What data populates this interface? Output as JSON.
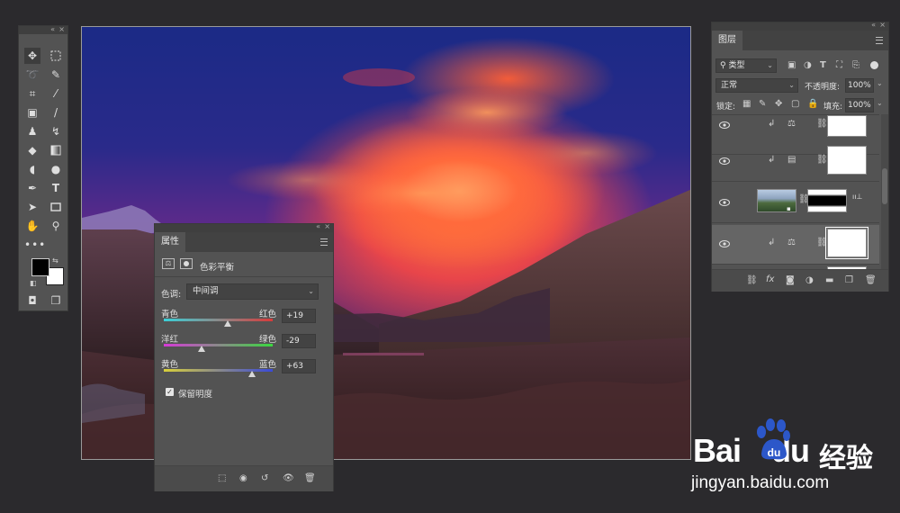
{
  "properties": {
    "tab": "属性",
    "title": "色彩平衡",
    "tone_label": "色调:",
    "tone_value": "中间调",
    "sliders": [
      {
        "left": "青色",
        "right": "红色",
        "value": "+19",
        "pos": 0.59
      },
      {
        "left": "洋红",
        "right": "绿色",
        "value": "-29",
        "pos": 0.35
      },
      {
        "left": "黄色",
        "right": "蓝色",
        "value": "+63",
        "pos": 0.81
      }
    ],
    "preserve_label": "保留明度"
  },
  "layers": {
    "tab": "图层",
    "filter_label": "类型",
    "blend_mode": "正常",
    "opacity_label": "不透明度:",
    "opacity_value": "100%",
    "lock_label": "锁定:",
    "fill_label": "填充:",
    "fill_value": "100%"
  },
  "watermark": {
    "brand": "Bai",
    "brand2": "du",
    "cn": "经验",
    "url": "jingyan.baidu.com"
  },
  "colors": {
    "panel": "#535353",
    "accent_blue": "#2c57c9"
  }
}
